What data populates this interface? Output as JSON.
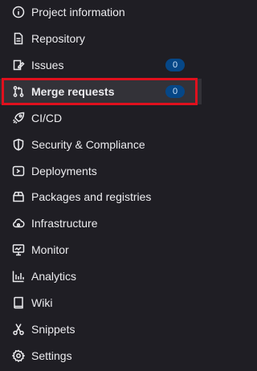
{
  "sidebar": {
    "items": [
      {
        "label": "Project information",
        "icon": "project-information-icon"
      },
      {
        "label": "Repository",
        "icon": "repository-icon"
      },
      {
        "label": "Issues",
        "icon": "issues-icon",
        "badge": "0"
      },
      {
        "label": "Merge requests",
        "icon": "merge-request-icon",
        "badge": "0",
        "active": true
      },
      {
        "label": "CI/CD",
        "icon": "rocket-icon"
      },
      {
        "label": "Security & Compliance",
        "icon": "shield-icon"
      },
      {
        "label": "Deployments",
        "icon": "deployments-icon"
      },
      {
        "label": "Packages and registries",
        "icon": "package-icon"
      },
      {
        "label": "Infrastructure",
        "icon": "infrastructure-icon"
      },
      {
        "label": "Monitor",
        "icon": "monitor-icon"
      },
      {
        "label": "Analytics",
        "icon": "analytics-icon"
      },
      {
        "label": "Wiki",
        "icon": "book-icon"
      },
      {
        "label": "Snippets",
        "icon": "snippet-icon"
      },
      {
        "label": "Settings",
        "icon": "gear-icon"
      }
    ]
  },
  "colors": {
    "background": "#1f1e24",
    "active_background": "#333238",
    "badge_background": "#064787",
    "highlight_border": "#e0101d"
  }
}
